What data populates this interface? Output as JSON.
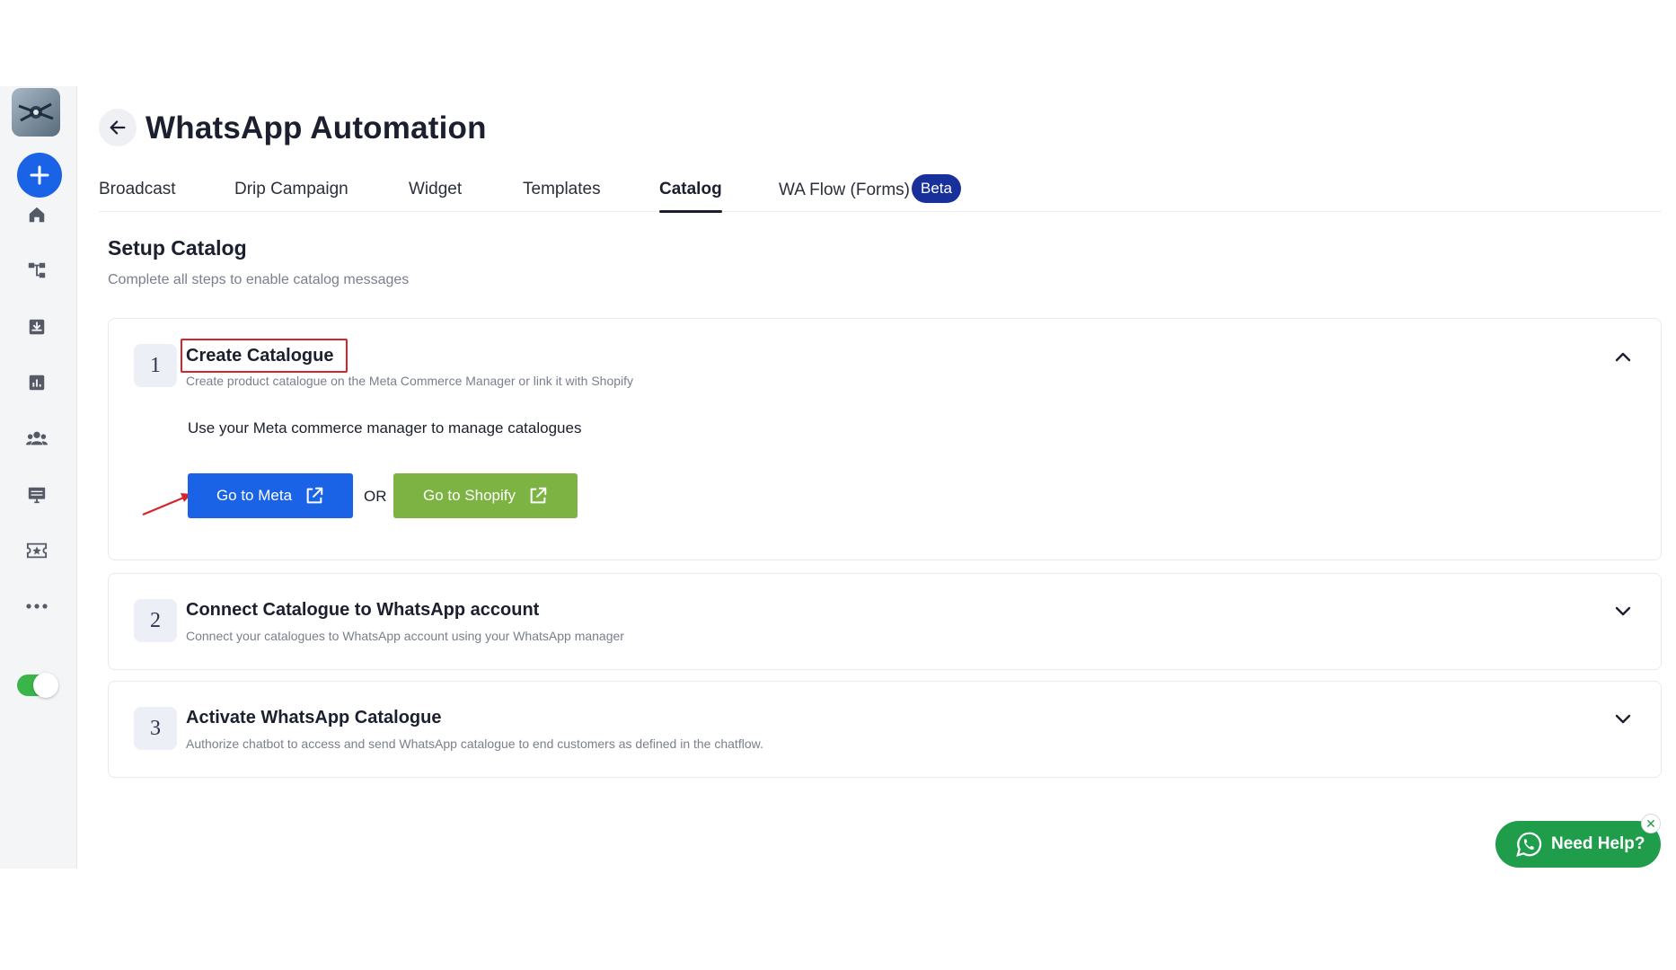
{
  "app": {
    "title": "WhatsApp Automation"
  },
  "sidebar": {
    "icons": [
      "home-icon",
      "flow-icon",
      "inbox-icon",
      "analytics-icon",
      "contacts-icon",
      "monitor-icon",
      "ticket-icon",
      "more-icon"
    ],
    "toggle_on": true
  },
  "tabs": [
    {
      "label": "Broadcast"
    },
    {
      "label": "Drip Campaign"
    },
    {
      "label": "Widget"
    },
    {
      "label": "Templates"
    },
    {
      "label": "Catalog",
      "active": true
    },
    {
      "label": "WA Flow (Forms)",
      "badge": "Beta"
    }
  ],
  "setup": {
    "title": "Setup Catalog",
    "subtitle": "Complete all steps to enable catalog messages",
    "steps": [
      {
        "number": "1",
        "title": "Create Catalogue",
        "description": "Create product catalogue on the Meta Commerce Manager or link it with Shopify",
        "expanded": true,
        "body_text": "Use your Meta commerce manager to manage catalogues",
        "primary_button": "Go to Meta",
        "separator": "OR",
        "secondary_button": "Go to Shopify"
      },
      {
        "number": "2",
        "title": "Connect Catalogue to WhatsApp account",
        "description": "Connect your catalogues to WhatsApp account using your WhatsApp manager",
        "expanded": false
      },
      {
        "number": "3",
        "title": "Activate WhatsApp Catalogue",
        "description": "Authorize chatbot to access and send WhatsApp catalogue to end customers as defined in the chatflow.",
        "expanded": false
      }
    ]
  },
  "help_widget": {
    "label": "Need Help?",
    "close": "✕"
  },
  "colors": {
    "primary": "#1b63e6",
    "shopify_green": "#7cb342",
    "beta_badge": "#18319a",
    "help_green": "#1f9d4b",
    "highlight_red": "#d8232a"
  }
}
